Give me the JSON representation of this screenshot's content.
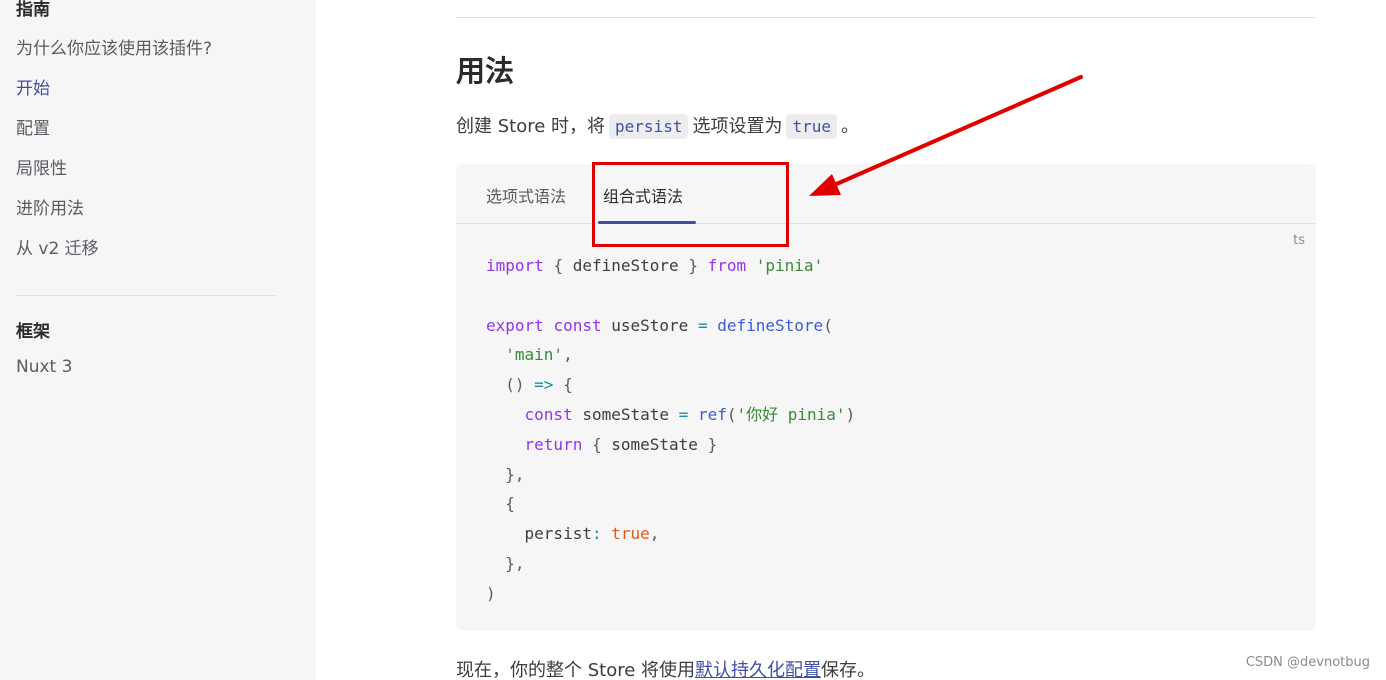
{
  "sidebar": {
    "section1_heading": "指南",
    "items": [
      {
        "label": "为什么你应该使用该插件?"
      },
      {
        "label": "开始"
      },
      {
        "label": "配置"
      },
      {
        "label": "局限性"
      },
      {
        "label": "进阶用法"
      },
      {
        "label": "从 v2 迁移"
      }
    ],
    "active_item": "开始",
    "section2_heading": "框架",
    "section2_items": [
      {
        "label": "Nuxt 3"
      }
    ]
  },
  "main": {
    "title": "用法",
    "intro": {
      "before": "创建 Store 时，将",
      "code1": "persist",
      "middle": "选项设置为",
      "code2": "true",
      "after": "。"
    },
    "code_tabs": [
      {
        "label": "选项式语法"
      },
      {
        "label": "组合式语法"
      }
    ],
    "active_tab": "组合式语法",
    "code_lang": "ts",
    "outro": {
      "before": "现在，你的整个 Store 将使用",
      "link": "默认持久化配置",
      "after": "保存。"
    }
  },
  "colors": {
    "accent": "#3f4fa8",
    "annotation": "#e00000",
    "sidebar_bg": "#f6f6f7"
  },
  "watermark": "CSDN @devnotbug"
}
